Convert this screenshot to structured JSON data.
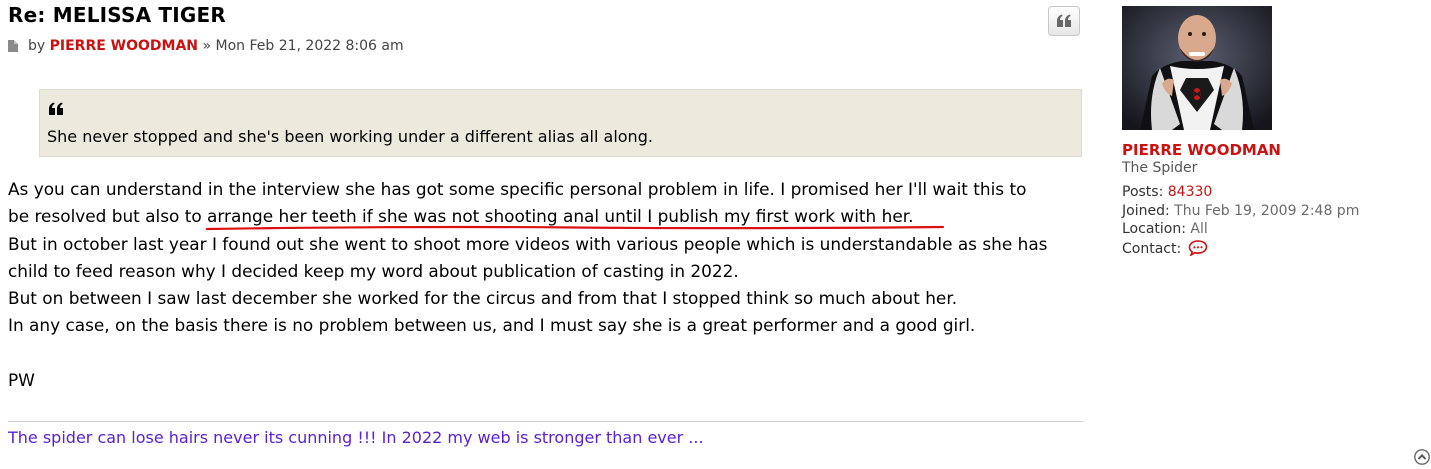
{
  "post": {
    "title": "Re: MELISSA TIGER",
    "by_label": "by",
    "author": "PIERRE WOODMAN",
    "separator": "»",
    "date": "Mon Feb 21, 2022 8:06 am",
    "quote_icon": "quote-icon",
    "quote_text": "She never stopped and she's been working under a different alias all along.",
    "body": {
      "line1": "As you can understand in the interview she has got some specific personal problem in life. I promised her I'll wait this to",
      "line2_pre": "be resolved but also to ",
      "line2_underlined": "arrange her teeth if she was not shooting anal until I publish my first work with her.",
      "line3": "But in october last year I found out she went to shoot more videos with various people which is understandable as she has",
      "line4": "child to feed reason why I decided keep my word about publication of casting in 2022.",
      "line5": "But on between I saw last december she worked for the circus and from that I stopped think so much about her.",
      "line6": "In any case, on the basis there is no problem between us, and I must say she is a great performer and a good girl.",
      "sign": "PW"
    },
    "signature": "The spider can lose hairs never its cunning !!! In 2022 my web is stronger than ever ..."
  },
  "profile": {
    "name": "PIERRE WOODMAN",
    "rank": "The Spider",
    "posts_label": "Posts:",
    "posts_value": "84330",
    "joined_label": "Joined:",
    "joined_value": "Thu Feb 19, 2009 2:48 pm",
    "location_label": "Location:",
    "location_value": "All",
    "contact_label": "Contact:"
  },
  "colors": {
    "author": "#cc1111",
    "signature": "#5b21d0",
    "quote_bg": "#ebeadc",
    "underline": "#dd1111"
  }
}
